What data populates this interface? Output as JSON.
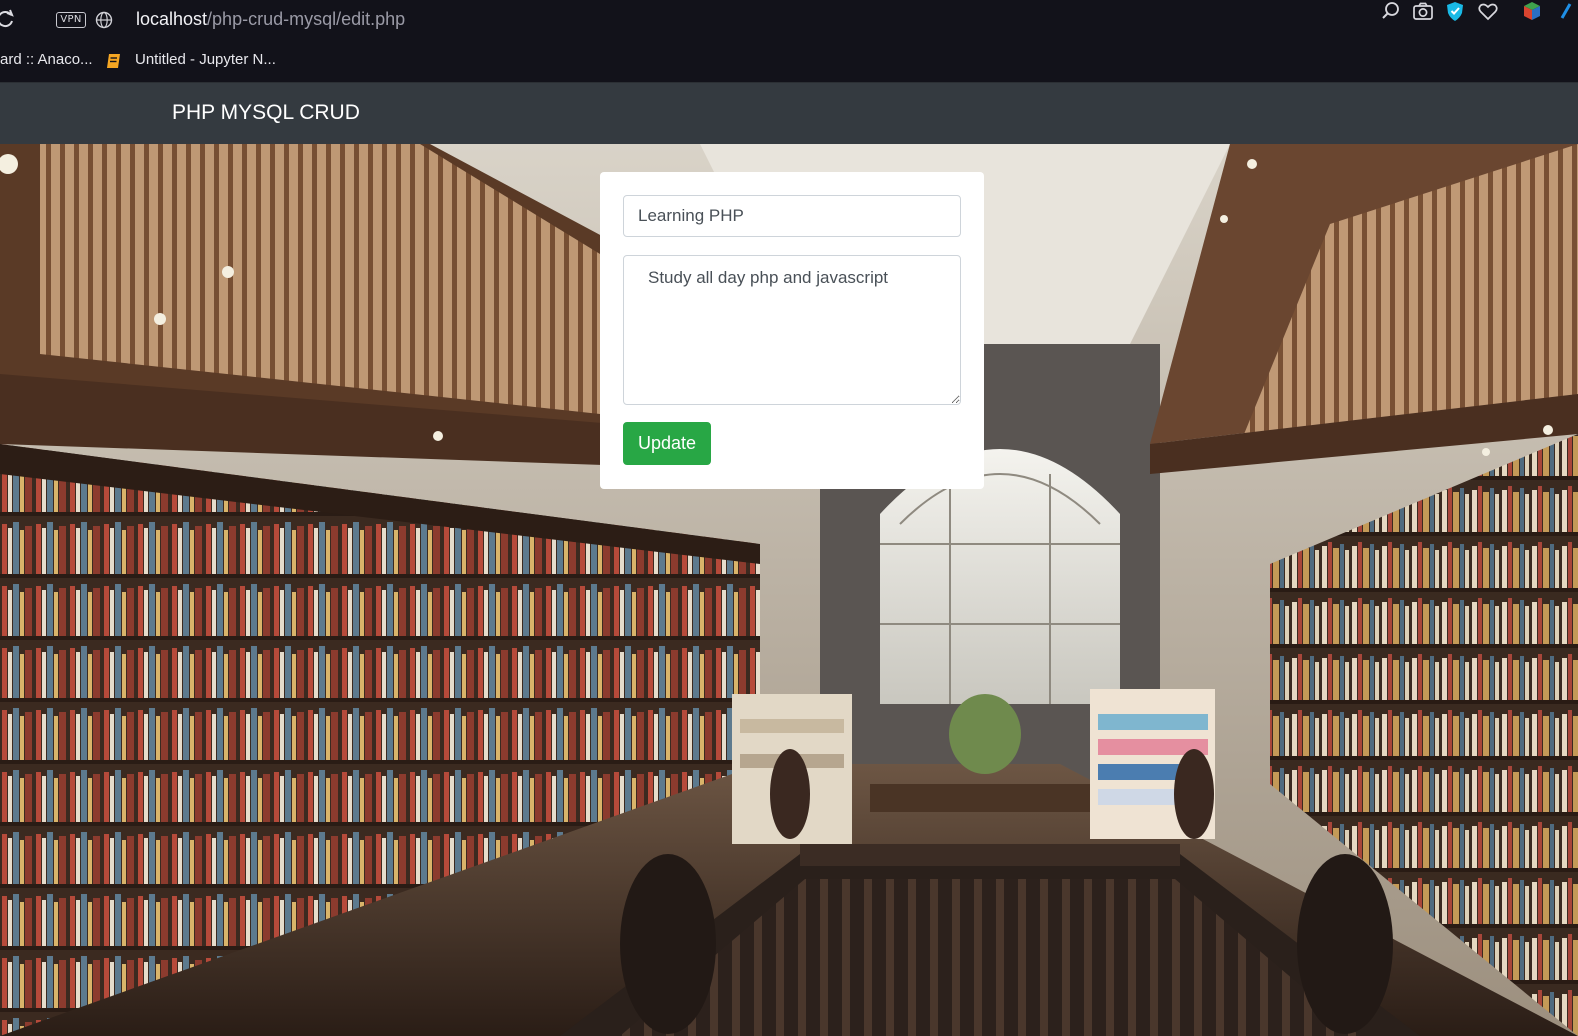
{
  "browser": {
    "url_host": "localhost",
    "url_path": "/php-crud-mysql/edit.php",
    "vpn_label": "VPN",
    "bookmarks": [
      {
        "label": "ard :: Anaco..."
      },
      {
        "label": "Untitled - Jupyter N..."
      }
    ],
    "icons": [
      "reload-icon",
      "globe-icon",
      "search-icon",
      "camera-icon",
      "shield-icon",
      "heart-icon",
      "extension-icon"
    ]
  },
  "navbar": {
    "brand": "PHP MYSQL CRUD",
    "background_color": "#343a40"
  },
  "form": {
    "title_value": "Learning PHP",
    "description_value": "Study all day php and javascript",
    "submit_label": "Update",
    "submit_color": "#28a745"
  }
}
